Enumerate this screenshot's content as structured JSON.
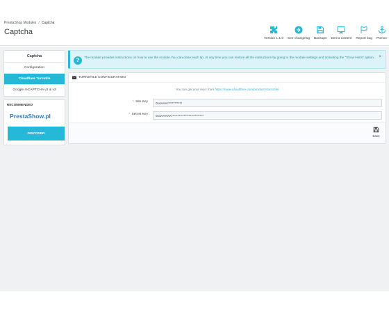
{
  "header": {
    "breadcrumb": {
      "parent": "PrestaShop Modules",
      "separator": "/",
      "current": "Captcha"
    },
    "title": "Captcha",
    "toolbar": [
      {
        "icon": "puzzle-icon",
        "label": "Version 1.1.0"
      },
      {
        "icon": "arrow-circle-icon",
        "label": "See changelog"
      },
      {
        "icon": "floppy-icon",
        "label": "Backups"
      },
      {
        "icon": "monitor-icon",
        "label": "Demo content"
      },
      {
        "icon": "flag-icon",
        "label": "Report bug"
      },
      {
        "icon": "lifebuoy-icon",
        "label": "Pomoc"
      }
    ]
  },
  "sidebar": {
    "title": "Captcha",
    "items": [
      {
        "label": "Configuration",
        "active": false
      },
      {
        "label": "Cloudflare Turnstile",
        "active": true
      },
      {
        "label": "Google reCAPTCHA v2 & v3",
        "active": false
      }
    ],
    "recommended": {
      "title": "Recommended",
      "logo": "PrestaShow.pl",
      "button": "Discover"
    }
  },
  "alert": {
    "text": "The module provides instructions on how to use the module.You can close each tip. At any time you can restore all the instructions by going to the module settings and activating the \"Show Hints\" option.",
    "close": "×"
  },
  "panel": {
    "heading": "Turnstile configuration",
    "info_prefix": "You can get your keys from",
    "info_link": "https://www.cloudflare.com/products/turnstile/",
    "fields": [
      {
        "required": "*",
        "label": "Site Key",
        "value": "0x4AAA************"
      },
      {
        "required": "*",
        "label": "Secret Key",
        "value": "0x4AAAAA**************************"
      }
    ],
    "save_label": "Save"
  },
  "colors": {
    "accent": "#25b9d7",
    "alert_bg": "#dcf4f9",
    "content_bg": "#eff1f2",
    "toolbar_icon": "#25b9d7",
    "logo": "#2b7bb9"
  }
}
